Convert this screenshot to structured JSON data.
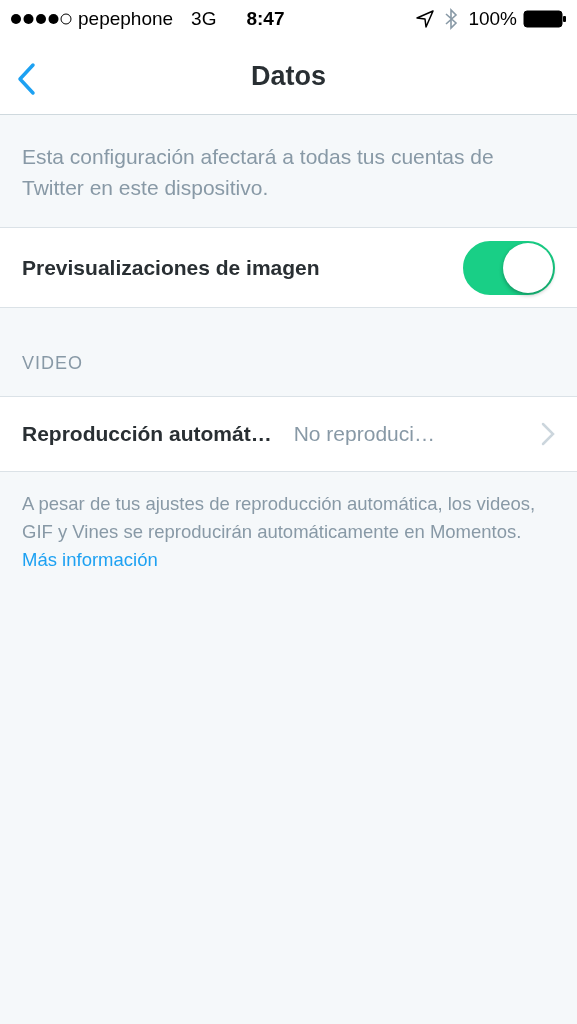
{
  "status_bar": {
    "carrier": "pepephone",
    "network": "3G",
    "time": "8:47",
    "battery": "100%"
  },
  "nav": {
    "title": "Datos"
  },
  "intro": "Esta configuración afectará a todas tus cuentas de Twitter en este dispositivo.",
  "toggle_row": {
    "label": "Previsualizaciones de imagen",
    "on": true
  },
  "section": {
    "header": "VIDEO",
    "rows": [
      {
        "label": "Reproducción automát…",
        "value": "No reproduci…"
      }
    ]
  },
  "footer": {
    "text": "A pesar de tus ajustes de reproducción automática, los videos, GIF y Vines se reproducirán automáticamente en Momentos.",
    "link": "Más información"
  }
}
